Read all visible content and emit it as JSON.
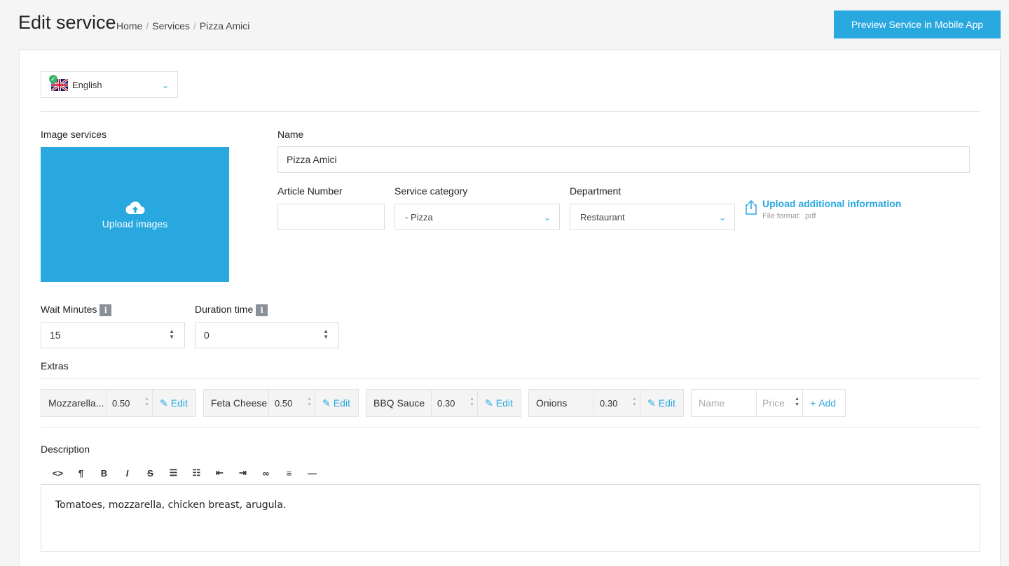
{
  "header": {
    "title": "Edit service",
    "breadcrumb": [
      "Home",
      "Services",
      "Pizza Amici"
    ],
    "preview_button": "Preview Service in Mobile App"
  },
  "language": {
    "selected": "English",
    "icon": "uk-flag-icon"
  },
  "image": {
    "label": "Image services",
    "upload_label": "Upload images"
  },
  "name": {
    "label": "Name",
    "value": "Pizza Amici"
  },
  "article_number": {
    "label": "Article Number",
    "value": ""
  },
  "service_category": {
    "label": "Service category",
    "value": "- Pizza"
  },
  "department": {
    "label": "Department",
    "value": "Restaurant"
  },
  "upload_info": {
    "title": "Upload additional information",
    "subtitle": "File format: .pdf"
  },
  "wait_minutes": {
    "label": "Wait Minutes",
    "value": "15"
  },
  "duration_time": {
    "label": "Duration time",
    "value": "0"
  },
  "extras": {
    "label": "Extras",
    "items": [
      {
        "name": "Mozzarella...",
        "price": "0.50",
        "edit": "Edit"
      },
      {
        "name": "Feta Cheese",
        "price": "0.50",
        "edit": "Edit"
      },
      {
        "name": "BBQ Sauce",
        "price": "0.30",
        "edit": "Edit"
      },
      {
        "name": "Onions",
        "price": "0.30",
        "edit": "Edit"
      }
    ],
    "new": {
      "name_placeholder": "Name",
      "price_placeholder": "Price",
      "add": "Add"
    }
  },
  "description": {
    "label": "Description",
    "text": "Tomatoes, mozzarella, chicken breast, arugula.",
    "toolbar": [
      "code",
      "paragraph",
      "bold",
      "italic",
      "strikethrough",
      "bullet-list",
      "numbered-list",
      "outdent",
      "indent",
      "link",
      "align",
      "horizontal-rule"
    ]
  },
  "colors": {
    "accent": "#29a8e0",
    "background": "#f5f5f5"
  }
}
